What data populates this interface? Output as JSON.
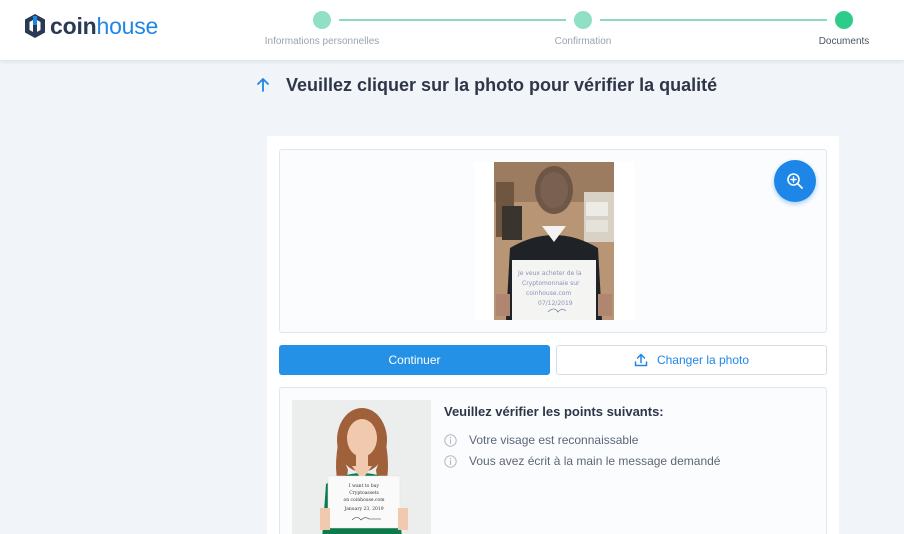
{
  "brand": {
    "name_part1": "coin",
    "name_part2": "house",
    "accent": "#1e86e6"
  },
  "stepper": {
    "steps": [
      {
        "label": "Informations personnelles",
        "color": "#8fe0c4"
      },
      {
        "label": "Confirmation",
        "color": "#8fe0c4"
      },
      {
        "label": "Documents",
        "color": "#2ecc8a"
      }
    ],
    "current_step": 3
  },
  "page": {
    "title": "Veuillez cliquer sur la photo pour vérifier la qualité",
    "icon": "arrow-up-icon"
  },
  "photo": {
    "zoom_icon": "zoom-in-icon",
    "sign_text": [
      "Je veux acheter de la",
      "Cryptomonnaie sur",
      "coinhouse.com",
      "07/12/2019"
    ]
  },
  "actions": {
    "continue_label": "Continuer",
    "change_label": "Changer la photo",
    "change_icon": "upload-icon"
  },
  "checklist": {
    "title": "Veuillez vérifier les points suivants:",
    "items": [
      "Votre visage est reconnaissable",
      "Vous avez écrit à la main le message demandé"
    ],
    "item_icon": "info-icon",
    "example_sign": [
      "I want to buy",
      "Cryptoassets",
      "on coinhouse.com",
      "January 23, 2019"
    ]
  }
}
